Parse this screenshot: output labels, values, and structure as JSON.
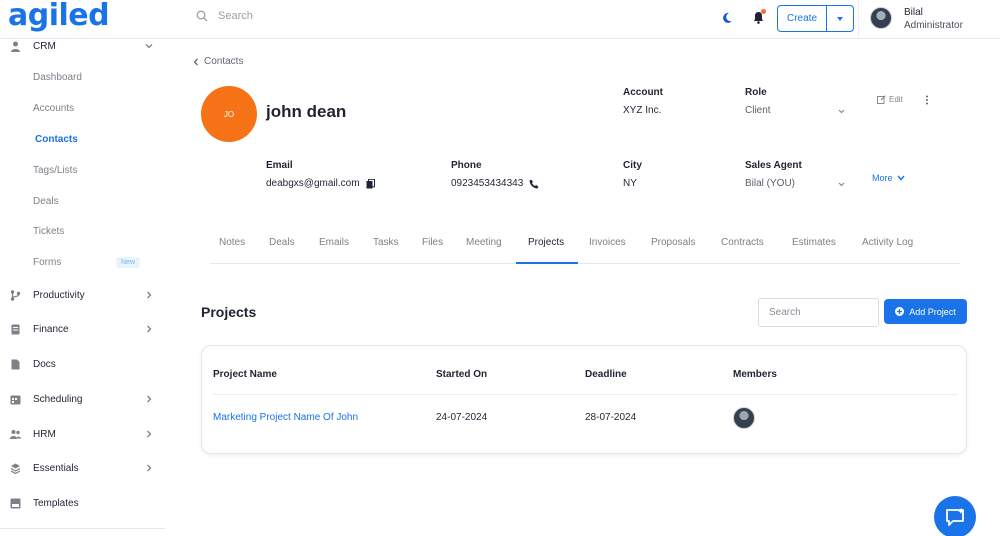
{
  "app": {
    "logo": "agiled"
  },
  "topbar": {
    "search_placeholder": "Search",
    "create_label": "Create",
    "user_name": "Bilal",
    "user_role": "Administrator"
  },
  "sidebar": {
    "crm_label": "CRM",
    "sub_items": [
      "Dashboard",
      "Accounts",
      "Contacts",
      "Tags/Lists",
      "Deals",
      "Tickets",
      "Forms"
    ],
    "forms_badge": "New",
    "sections": [
      "Productivity",
      "Finance",
      "Docs",
      "Scheduling",
      "HRM",
      "Essentials",
      "Templates"
    ]
  },
  "breadcrumb": {
    "back_label": "Contacts"
  },
  "contact": {
    "initials": "JO",
    "name": "john dean",
    "account_label": "Account",
    "account_value": "XYZ Inc.",
    "role_label": "Role",
    "role_value": "Client",
    "email_label": "Email",
    "email_value": "deabgxs@gmail.com",
    "phone_label": "Phone",
    "phone_value": "0923453434343",
    "city_label": "City",
    "city_value": "NY",
    "agent_label": "Sales Agent",
    "agent_value": "Bilal (YOU)",
    "edit_label": "Edit",
    "more_label": "More"
  },
  "tabs": [
    "Notes",
    "Deals",
    "Emails",
    "Tasks",
    "Files",
    "Meeting",
    "Projects",
    "Invoices",
    "Proposals",
    "Contracts",
    "Estimates",
    "Activity Log"
  ],
  "active_tab": "Projects",
  "projects": {
    "title": "Projects",
    "search_placeholder": "Search",
    "add_label": "Add Project",
    "columns": [
      "Project Name",
      "Started On",
      "Deadline",
      "Members"
    ],
    "rows": [
      {
        "name": "Marketing Project Name Of John",
        "started": "24-07-2024",
        "deadline": "28-07-2024"
      }
    ]
  },
  "colors": {
    "accent": "#1a73e8",
    "avatar": "#f57216"
  }
}
